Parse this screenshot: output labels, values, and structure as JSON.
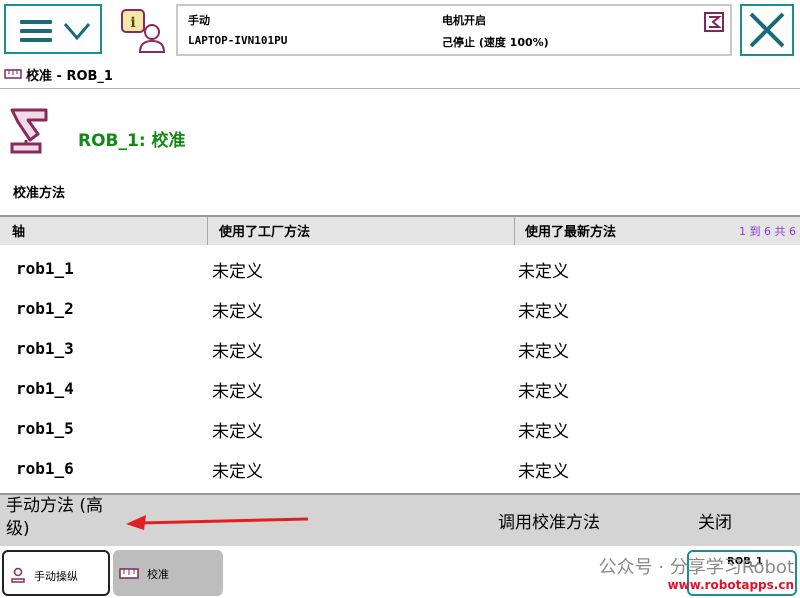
{
  "header": {
    "mode": "手动",
    "host": "LAPTOP-IVN101PU",
    "motor_state": "电机开启",
    "run_state": "己停止 (速度 100%)"
  },
  "title_bar": {
    "title": "校准 - ROB_1"
  },
  "page": {
    "title": "ROB_1:  校准",
    "section_label": "校准方法"
  },
  "table": {
    "columns": [
      "轴",
      "使用了工厂方法",
      "使用了最新方法"
    ],
    "pager": "1 到 6 共 6",
    "rows": [
      {
        "axis": "rob1_1",
        "factory": "未定义",
        "latest": "未定义"
      },
      {
        "axis": "rob1_2",
        "factory": "未定义",
        "latest": "未定义"
      },
      {
        "axis": "rob1_3",
        "factory": "未定义",
        "latest": "未定义"
      },
      {
        "axis": "rob1_4",
        "factory": "未定义",
        "latest": "未定义"
      },
      {
        "axis": "rob1_5",
        "factory": "未定义",
        "latest": "未定义"
      },
      {
        "axis": "rob1_6",
        "factory": "未定义",
        "latest": "未定义"
      }
    ]
  },
  "actions": {
    "manual_method_line1": "手动方法 (高",
    "manual_method_line2": "级)",
    "call_calibration": "调用校准方法",
    "close": "关闭"
  },
  "taskbar": {
    "jog": "手动操纵",
    "calibration": "校准",
    "rob_badge": "ROB_1"
  },
  "watermark": {
    "text": "公众号 · 分享学习Robot",
    "site": "www.robotapps.cn"
  },
  "colors": {
    "accent": "#1a8e91",
    "title_green": "#148a14",
    "pager_purple": "#8a3ad6",
    "arrow_red": "#e02020"
  },
  "icons": {
    "menu": "hamburger-icon",
    "info": "event-log-icon",
    "close": "close-icon",
    "robot": "robot-arm-icon"
  }
}
